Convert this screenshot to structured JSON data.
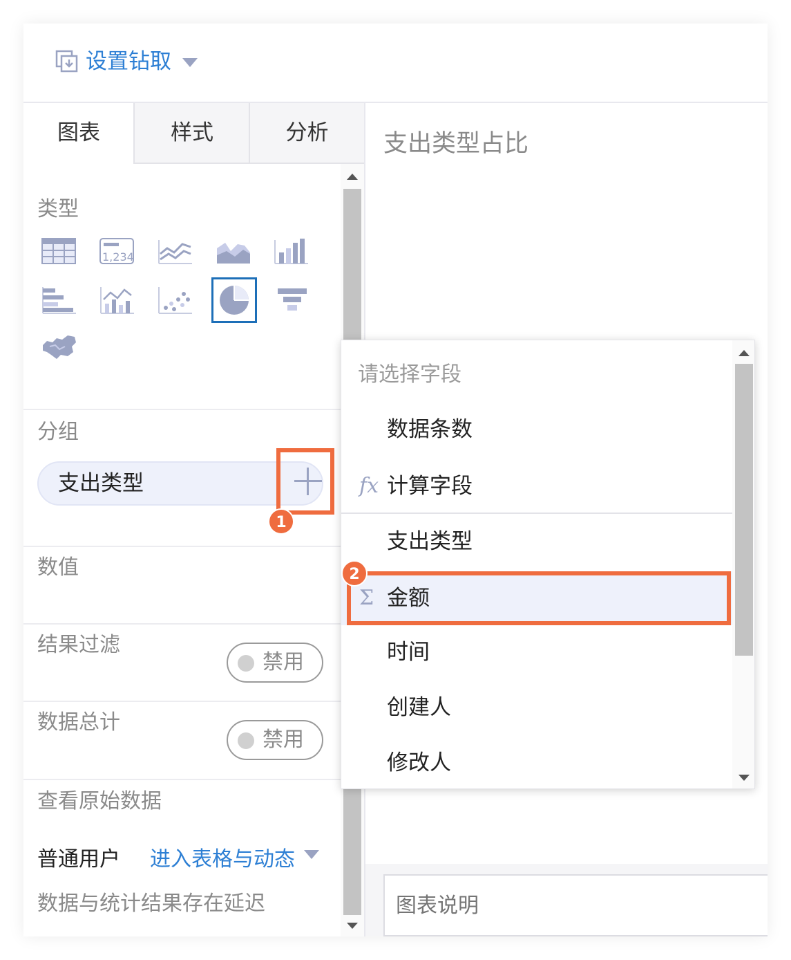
{
  "header": {
    "drill_label": "设置钻取",
    "drill_icon": "drill-icon"
  },
  "tabs": [
    {
      "label": "图表",
      "active": true
    },
    {
      "label": "样式",
      "active": false
    },
    {
      "label": "分析",
      "active": false
    }
  ],
  "sections": {
    "type_label": "类型",
    "group_label": "分组",
    "group_value": "支出类型",
    "value_label": "数值",
    "filter_label": "结果过滤",
    "total_label": "数据总计",
    "raw_label": "查看原始数据"
  },
  "chart_types": [
    "table",
    "indicator-card",
    "line",
    "area",
    "bar",
    "horizontal-bar",
    "combo",
    "scatter",
    "pie",
    "funnel",
    "map"
  ],
  "toggles": {
    "disabled_label": "禁用"
  },
  "raw_data": {
    "user_label": "普通用户",
    "enter_link": "进入表格与动态",
    "delay_note": "数据与统计结果存在延迟"
  },
  "badges": {
    "step1": "1",
    "step2": "2"
  },
  "chart": {
    "title": "支出类型占比",
    "description_placeholder": "图表说明"
  },
  "dropdown": {
    "prompt": "请选择字段",
    "items": [
      {
        "label": "数据条数",
        "icon": ""
      },
      {
        "label": "计算字段",
        "icon": "fx"
      },
      {
        "label": "支出类型",
        "icon": ""
      },
      {
        "label": "金额",
        "icon": "Σ",
        "selected": true
      },
      {
        "label": "时间",
        "icon": ""
      },
      {
        "label": "创建人",
        "icon": ""
      },
      {
        "label": "修改人",
        "icon": ""
      }
    ]
  },
  "colors": {
    "accent": "#2d7fd4",
    "highlight": "#ef6c3f",
    "icon": "#9aa3c2"
  }
}
